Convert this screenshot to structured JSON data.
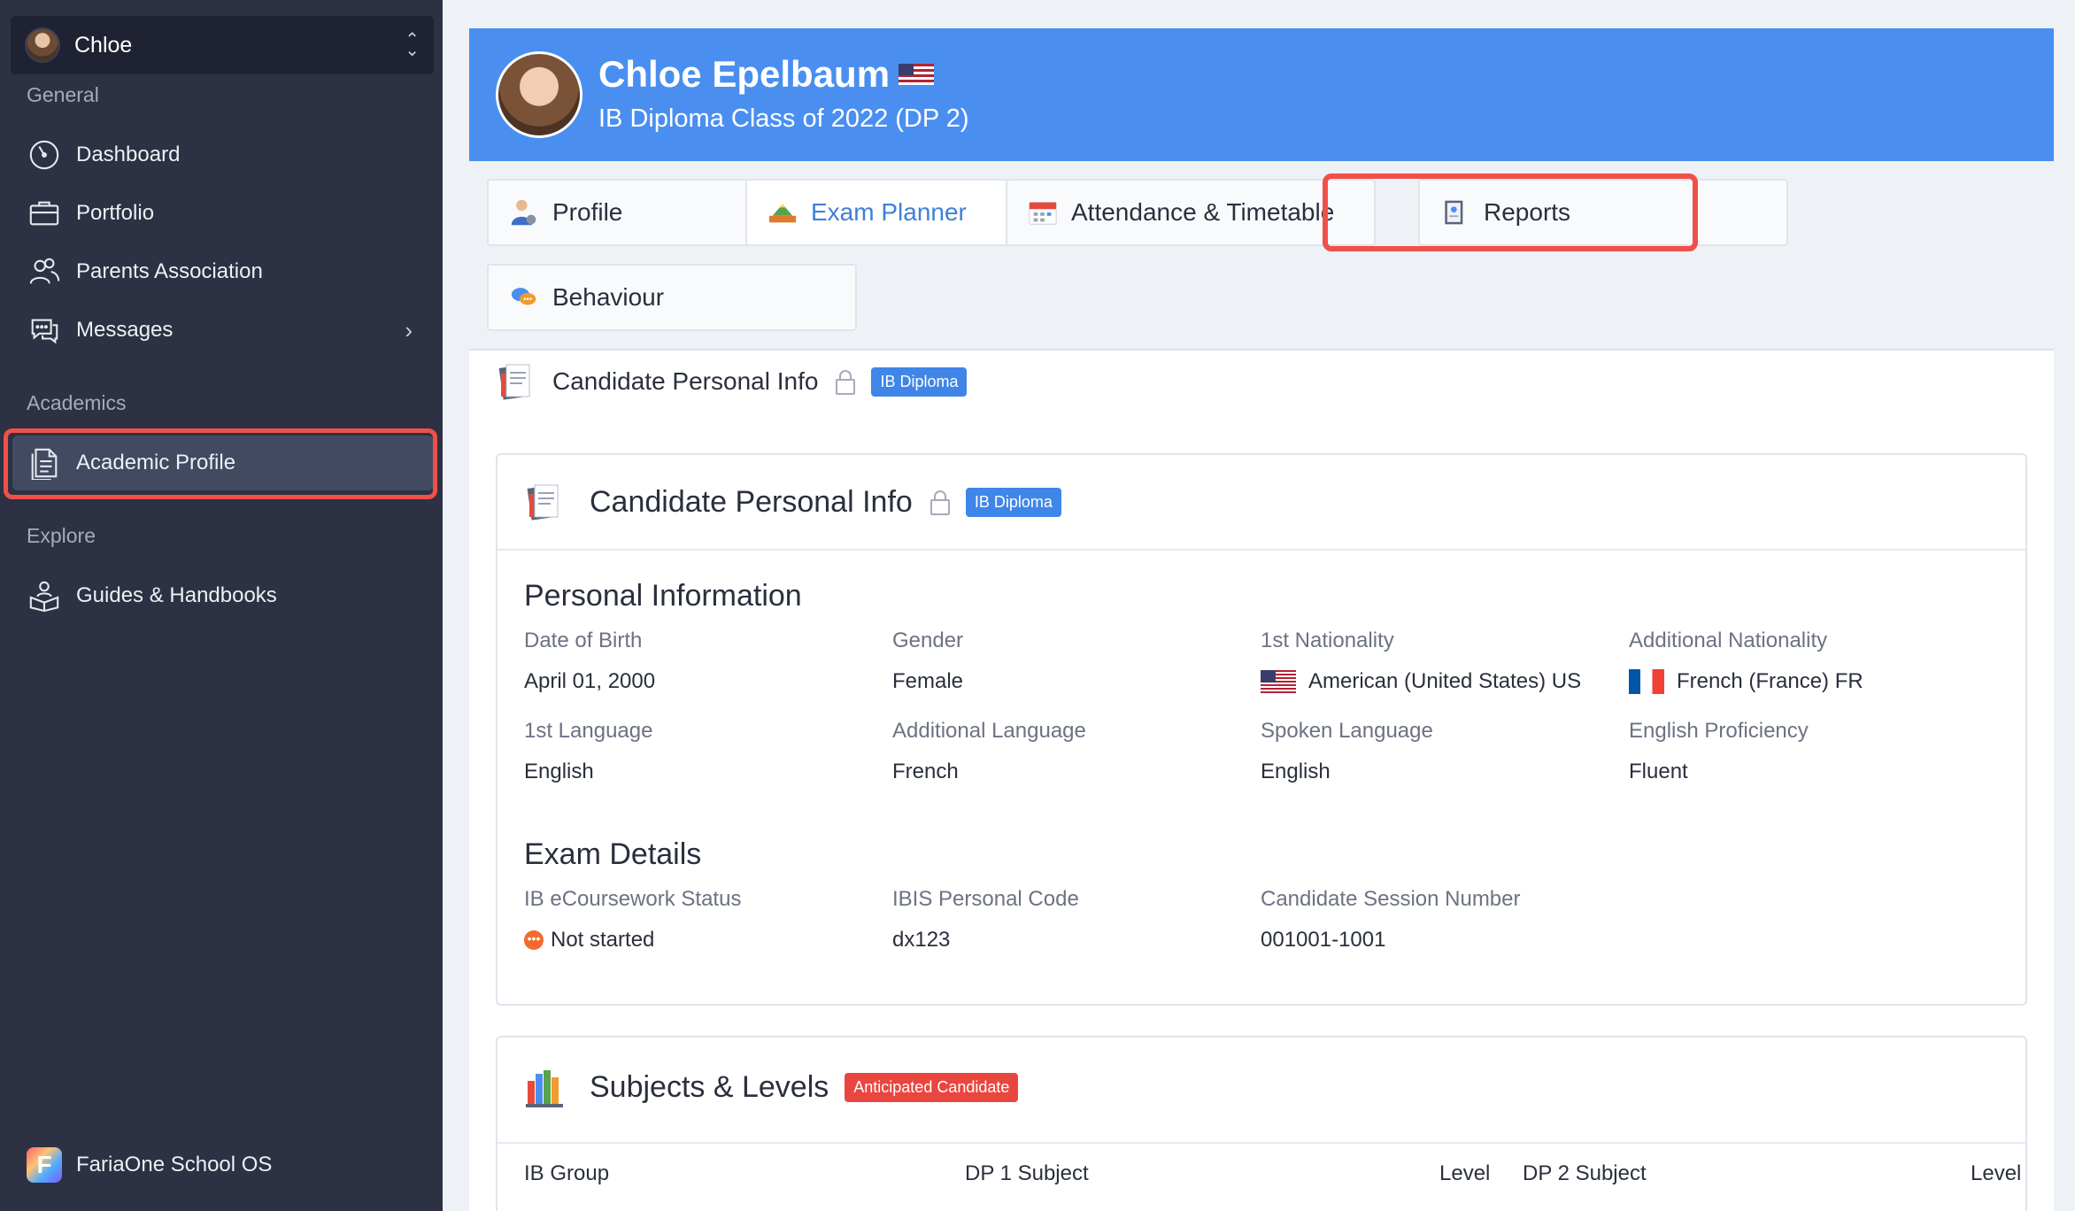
{
  "sidebar": {
    "user": {
      "name": "Chloe"
    },
    "sections": {
      "general": "General",
      "academics": "Academics",
      "explore": "Explore"
    },
    "items": {
      "dashboard": "Dashboard",
      "portfolio": "Portfolio",
      "parents": "Parents Association",
      "messages": "Messages",
      "academic_profile": "Academic Profile",
      "guides": "Guides & Handbooks"
    },
    "brand": "FariaOne School OS"
  },
  "header": {
    "name": "Chloe Epelbaum",
    "class": "IB Diploma Class of 2022 (DP 2)"
  },
  "tabs": {
    "profile": "Profile",
    "exam_planner": "Exam Planner",
    "attendance": "Attendance & Timetable",
    "reports": "Reports",
    "behaviour": "Behaviour"
  },
  "crumb": {
    "title": "Candidate Personal Info",
    "badge": "IB Diploma"
  },
  "card": {
    "title": "Candidate Personal Info",
    "badge": "IB Diploma",
    "personal": {
      "title": "Personal Information",
      "dob_label": "Date of Birth",
      "dob": "April 01, 2000",
      "gender_label": "Gender",
      "gender": "Female",
      "nat1_label": "1st Nationality",
      "nat1": "American (United States) US",
      "nat2_label": "Additional Nationality",
      "nat2": "French (France) FR",
      "lang1_label": "1st Language",
      "lang1": "English",
      "lang2_label": "Additional Language",
      "lang2": "French",
      "spoken_label": "Spoken Language",
      "spoken": "English",
      "prof_label": "English Proficiency",
      "prof": "Fluent"
    },
    "exam": {
      "title": "Exam Details",
      "ecw_label": "IB eCoursework Status",
      "ecw": "Not started",
      "ibis_label": "IBIS Personal Code",
      "ibis": "dx123",
      "session_label": "Candidate Session Number",
      "session": "001001-1001"
    }
  },
  "subjects": {
    "title": "Subjects & Levels",
    "badge": "Anticipated Candidate",
    "columns": {
      "group": "IB Group",
      "dp1": "DP 1 Subject",
      "level1": "Level",
      "dp2": "DP 2 Subject",
      "level2": "Level"
    }
  },
  "colors": {
    "sidebar": "#2c3143",
    "header": "#4a8ff0",
    "accent": "#3f7fd8",
    "highlight": "#f0504a"
  }
}
